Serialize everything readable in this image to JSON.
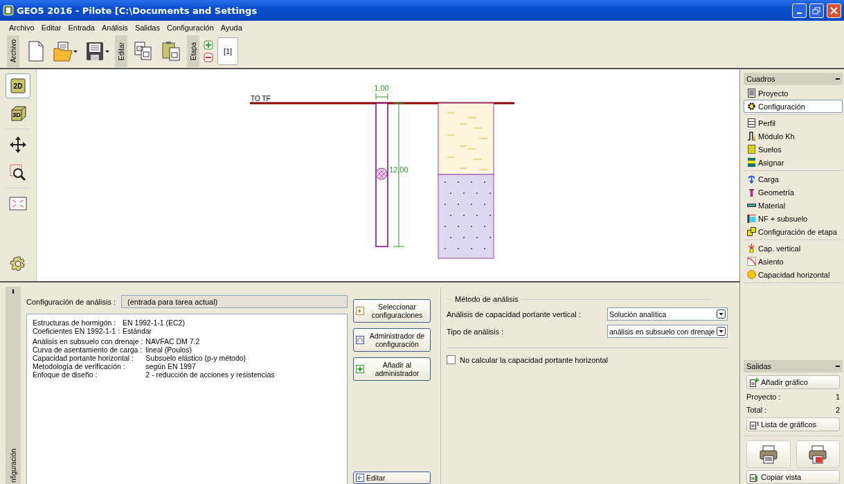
{
  "window": {
    "title": "GEO5 2016 - Pilote [C:\\Documents and Settings"
  },
  "menu": [
    {
      "label": "Archivo"
    },
    {
      "label": "Editar"
    },
    {
      "label": "Entrada"
    },
    {
      "label": "Análisis"
    },
    {
      "label": "Salidas"
    },
    {
      "label": "Configuración"
    },
    {
      "label": "Ayuda"
    }
  ],
  "toolbar": {
    "groups": [
      {
        "label": "Archivo"
      },
      {
        "label": "Editar"
      },
      {
        "label": "Etapa"
      }
    ],
    "stage": "[1]"
  },
  "view_tools": [
    {
      "label": "2D",
      "selected": true
    },
    {
      "label": "3D",
      "selected": false
    }
  ],
  "drawing": {
    "level_label": "TO TF",
    "diameter": "1,00",
    "length": "12,00"
  },
  "config_panel": {
    "tab": "nfiguración",
    "settings_label": "Configuración de análisis :",
    "settings_value": "(entrada para tarea actual)",
    "detail_groups": [
      [
        {
          "label": "Estructuras de hormigón :",
          "value": "EN 1992-1-1 (EC2)"
        },
        {
          "label": "Coeficientes EN 1992-1-1 :",
          "value": "Estándar"
        }
      ],
      [
        {
          "label": "Análisis en subsuelo con drenaje :",
          "value": "NAVFAC DM 7.2"
        },
        {
          "label": "Curva de asentamiento de carga :",
          "value": "lineal (Poulos)"
        },
        {
          "label": "Capacidad portante horizontal :",
          "value": "Subsuelo elástico (p-y método)"
        },
        {
          "label": "Metodología de verificación :",
          "value": "según EN 1997"
        },
        {
          "label": "Enfoque de diseño :",
          "value": "2 - reducción de acciones y resistencias"
        }
      ]
    ],
    "buttons": [
      {
        "label": "Seleccionar configuraciones"
      },
      {
        "label": "Administrador de configuración"
      },
      {
        "label": "Añadir al administrador"
      }
    ],
    "edit_button": {
      "label": "Editar"
    },
    "method": {
      "title": "Método de análisis",
      "fields": [
        {
          "label": "Análisis de capacidad portante vertical :",
          "value": "Solución analítica"
        },
        {
          "label": "Tipo de análisis :",
          "value": "análisis en subsuelo con drenaje"
        }
      ],
      "checkbox": {
        "label": "No calcular la capacidad portante horizontal",
        "checked": false
      }
    }
  },
  "sidebar": {
    "title": "Cuadros",
    "groups": [
      [
        {
          "label": "Proyecto",
          "selected": false
        },
        {
          "label": "Configuración",
          "selected": true
        }
      ],
      [
        {
          "label": "Perfil",
          "selected": false
        },
        {
          "label": "Módulo Kh",
          "selected": false
        },
        {
          "label": "Suelos",
          "selected": false
        },
        {
          "label": "Asignar",
          "selected": false
        }
      ],
      [
        {
          "label": "Carga",
          "selected": false
        },
        {
          "label": "Geometría",
          "selected": false
        },
        {
          "label": "Material",
          "selected": false
        },
        {
          "label": "NF + subsuelo",
          "selected": false
        },
        {
          "label": "Configuración de etapa",
          "selected": false
        }
      ],
      [
        {
          "label": "Cap. vertical",
          "selected": false
        },
        {
          "label": "Asiento",
          "selected": false
        },
        {
          "label": "Capacidad horizontal",
          "selected": false
        }
      ]
    ]
  },
  "outputs": {
    "title": "Salidas",
    "add_button": "Añadir gráfico",
    "counts": [
      {
        "label": "Proyecto :",
        "value": "1"
      },
      {
        "label": "Total :",
        "value": "2"
      }
    ],
    "list_button": "Lista de gráficos",
    "copy_button": "Copiar vista"
  }
}
